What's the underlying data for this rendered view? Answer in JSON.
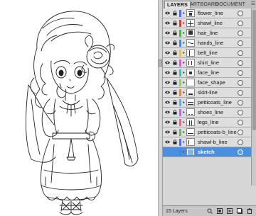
{
  "panel": {
    "tabs": [
      {
        "label": "LAYERS",
        "active": true
      },
      {
        "label": "ARTBOARD",
        "active": false
      },
      {
        "label": "DOCUMENT",
        "active": false
      }
    ],
    "menu_icon": "panel-menu-icon",
    "footer": {
      "layer_count": "15 Layers",
      "buttons": [
        "locate-object-icon",
        "make-clipping-mask-icon",
        "new-sublayer-icon",
        "new-layer-icon",
        "trash-icon"
      ]
    }
  },
  "layers": [
    {
      "name": "flower_line",
      "color": "#4a6cff",
      "visible": true,
      "locked": true,
      "selected": false
    },
    {
      "name": "shawl_line",
      "color": "#e53a3a",
      "visible": true,
      "locked": true,
      "selected": false
    },
    {
      "name": "hair_line",
      "color": "#3ac23a",
      "visible": true,
      "locked": true,
      "selected": false
    },
    {
      "name": "hands_line",
      "color": "#3a8de5",
      "visible": true,
      "locked": true,
      "selected": false
    },
    {
      "name": "belt_line",
      "color": "#e5c33a",
      "visible": true,
      "locked": true,
      "selected": false
    },
    {
      "name": "shirt_line",
      "color": "#d95ae0",
      "visible": true,
      "locked": true,
      "selected": false
    },
    {
      "name": "face_line",
      "color": "#3ac2c2",
      "visible": true,
      "locked": true,
      "selected": false
    },
    {
      "name": "face_shape",
      "color": "#8ad16c",
      "visible": true,
      "locked": true,
      "selected": false
    },
    {
      "name": "skirt-line",
      "color": "#e58a3a",
      "visible": true,
      "locked": true,
      "selected": false
    },
    {
      "name": "petticoats_line",
      "color": "#5ab0e6",
      "visible": true,
      "locked": true,
      "selected": false
    },
    {
      "name": "shoes_line",
      "color": "#b86be0",
      "visible": true,
      "locked": true,
      "selected": false
    },
    {
      "name": "legs_line",
      "color": "#e56a8a",
      "visible": true,
      "locked": true,
      "selected": false
    },
    {
      "name": "petticoats-b_line",
      "color": "#6ab86b",
      "visible": true,
      "locked": true,
      "selected": false
    },
    {
      "name": "shawl-b_line",
      "color": "#4a6cff",
      "visible": true,
      "locked": true,
      "selected": false
    },
    {
      "name": "sketch",
      "color": "#3a8de5",
      "visible": false,
      "locked": false,
      "selected": true
    }
  ]
}
